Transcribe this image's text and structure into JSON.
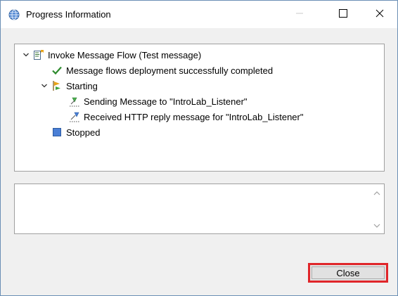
{
  "window": {
    "title": "Progress Information",
    "controls": {
      "minimize_icon": "minimize-icon",
      "maximize_icon": "maximize-icon",
      "close_icon": "close-icon"
    }
  },
  "tree": {
    "items": [
      {
        "label": "Invoke Message Flow (Test message)",
        "icon": "invoke-flow-icon",
        "expanded": true,
        "level": 0
      },
      {
        "label": "Message flows deployment successfully completed",
        "icon": "checkmark-icon",
        "level": 1
      },
      {
        "label": "Starting",
        "icon": "starting-flag-icon",
        "expanded": true,
        "level": 1
      },
      {
        "label": "Sending Message to \"IntroLab_Listener\"",
        "icon": "send-message-icon",
        "level": 2
      },
      {
        "label": "Received HTTP reply message for \"IntroLab_Listener\"",
        "icon": "receive-message-icon",
        "level": 2
      },
      {
        "label": "Stopped",
        "icon": "stop-icon",
        "level": 1
      }
    ]
  },
  "details": {
    "text": ""
  },
  "buttons": {
    "close_label": "Close"
  },
  "colors": {
    "highlight_border": "#e0262a",
    "check_green": "#2e8b2e"
  }
}
